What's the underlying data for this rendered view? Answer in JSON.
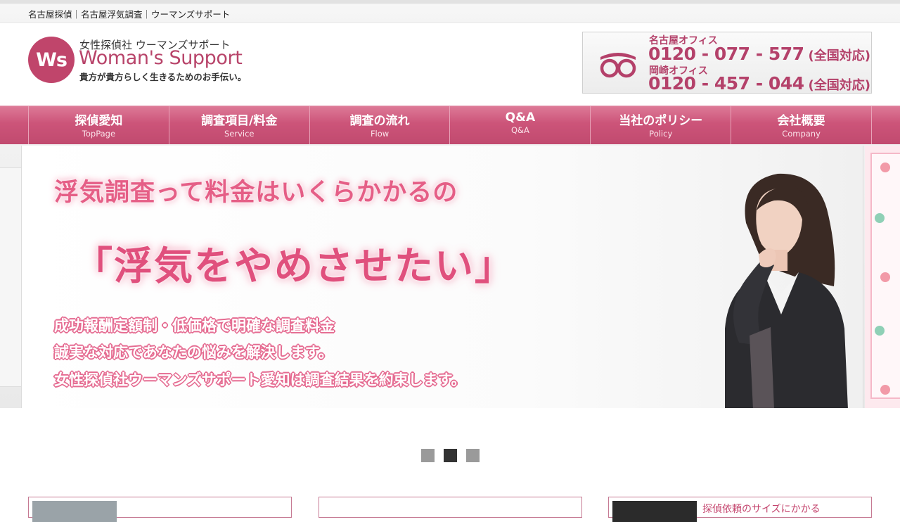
{
  "topbar": {
    "breadcrumb": "名古屋探偵｜名古屋浮気調査｜ウーマンズサポート"
  },
  "header": {
    "logo": {
      "mark": "Ws",
      "tagline_top": "女性探偵社 ウーマンズサポート",
      "name": "Woman's Support",
      "tagline_bottom": "貴方が貴方らしく生きるためのお手伝い。"
    },
    "phone": {
      "office1_label": "名古屋オフィス",
      "office1_number": "0120 - 077 - 577",
      "office1_note": "(全国対応)",
      "office2_label": "岡崎オフィス",
      "office2_number": "0120 - 457 - 044",
      "office2_note": "(全国対応)",
      "icon": "freedial-icon"
    }
  },
  "nav": {
    "items": [
      {
        "jp": "探偵愛知",
        "en": "TopPage"
      },
      {
        "jp": "調査項目/料金",
        "en": "Service"
      },
      {
        "jp": "調査の流れ",
        "en": "Flow"
      },
      {
        "jp": "Q&A",
        "en": "Q&A"
      },
      {
        "jp": "当社のポリシー",
        "en": "Policy"
      },
      {
        "jp": "会社概要",
        "en": "Company"
      }
    ]
  },
  "slider": {
    "question": "浮気調査って料金はいくらかかるの",
    "headline": "「浮気をやめさせたい」",
    "lines": [
      "成功報酬定額制・低価格で明確な調査料金",
      "誠実な対応であなたの悩みを解決します。",
      "女性探偵社ウーマンズサポート愛知は調査結果を約束します。"
    ],
    "pager_count": 3,
    "active_index": 1
  },
  "cards": [
    {
      "title": ""
    },
    {
      "title": ""
    },
    {
      "title": "探偵依頼のサイズにかかる"
    }
  ],
  "colors": {
    "brand": "#c0456b",
    "nav": "#cc5479",
    "pager_active": "#333333",
    "pager": "#9a9a9a"
  }
}
